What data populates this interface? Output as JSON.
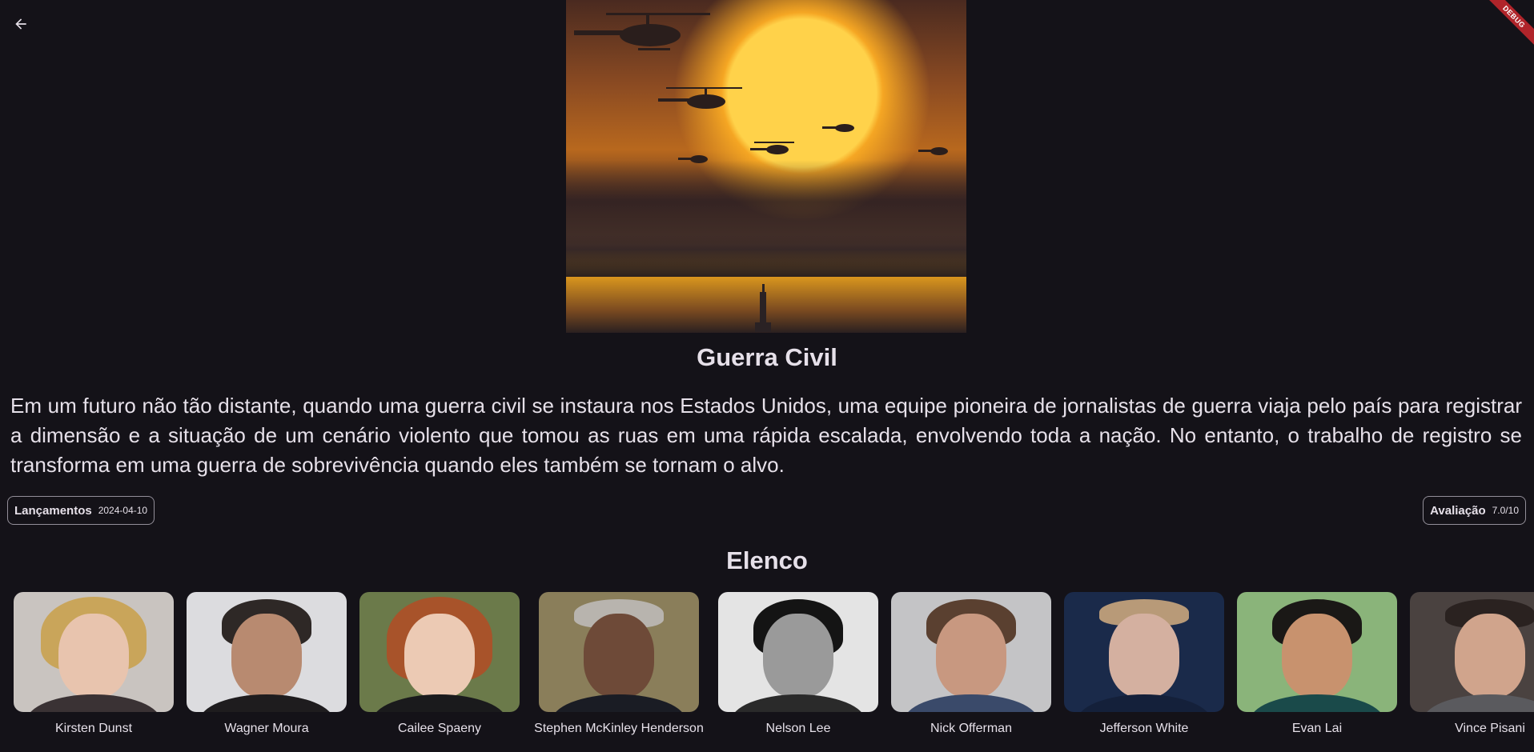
{
  "app": {
    "debug_banner": "DEBUG"
  },
  "movie": {
    "title": "Guerra Civil",
    "overview": "Em um futuro não tão distante, quando uma guerra civil se instaura nos Estados Unidos, uma equipe pioneira de jornalistas de guerra viaja pelo país para registrar a dimensão e a situação de um cenário violento que tomou as ruas em uma rápida escalada, envolvendo toda a nação. No entanto, o trabalho de registro se transforma em uma guerra de sobrevivência quando eles também se tornam o alvo.",
    "release": {
      "label": "Lançamentos",
      "value": "2024-04-10"
    },
    "rating": {
      "label": "Avaliação",
      "value": "7.0/10"
    }
  },
  "cast": {
    "heading": "Elenco",
    "members": [
      {
        "name": "Kirsten Dunst"
      },
      {
        "name": "Wagner Moura"
      },
      {
        "name": "Cailee Spaeny"
      },
      {
        "name": "Stephen McKinley Henderson"
      },
      {
        "name": "Nelson Lee"
      },
      {
        "name": "Nick Offerman"
      },
      {
        "name": "Jefferson White"
      },
      {
        "name": "Evan Lai"
      },
      {
        "name": "Vince Pisani"
      }
    ]
  },
  "icons": {
    "back": "arrow-left-icon"
  }
}
